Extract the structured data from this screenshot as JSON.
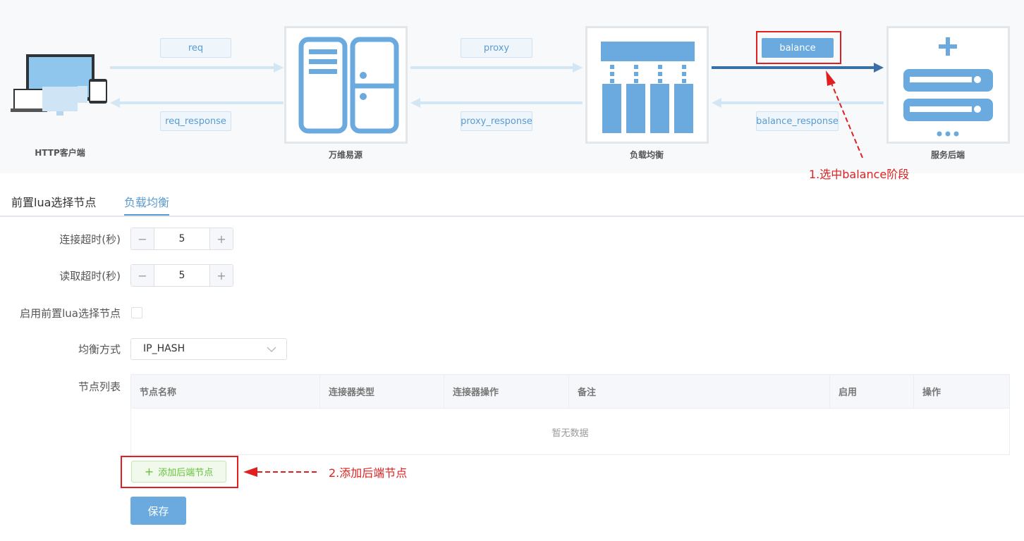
{
  "flow": {
    "nodes": {
      "client": "HTTP客户端",
      "wanwei": "万维易源",
      "lb": "负载均衡",
      "backend": "服务后端"
    },
    "stages": {
      "req": "req",
      "req_response": "req_response",
      "proxy": "proxy",
      "proxy_response": "proxy_response",
      "balance": "balance",
      "balance_response": "balance_response"
    },
    "annotations": {
      "step1": "1.选中balance阶段",
      "step2": "2.添加后端节点"
    }
  },
  "tabs": [
    {
      "label": "前置lua选择节点",
      "active": false
    },
    {
      "label": "负载均衡",
      "active": true
    }
  ],
  "form": {
    "connect_timeout": {
      "label": "连接超时(秒)",
      "value": "5"
    },
    "read_timeout": {
      "label": "读取超时(秒)",
      "value": "5"
    },
    "enable_lua": {
      "label": "启用前置lua选择节点",
      "checked": false
    },
    "balance_method": {
      "label": "均衡方式",
      "value": "IP_HASH"
    },
    "node_list": {
      "label": "节点列表",
      "columns": [
        "节点名称",
        "连接器类型",
        "连接器操作",
        "备注",
        "启用",
        "操作"
      ],
      "empty_text": "暂无数据"
    },
    "add_node_label": "添加后端节点",
    "save_label": "保存"
  },
  "colors": {
    "accent": "#5b9bd0",
    "icon_blue": "#6aaadf",
    "arrow_dark": "#3a6fa8",
    "annotation_red": "#e02020",
    "success_green": "#67c23a"
  }
}
